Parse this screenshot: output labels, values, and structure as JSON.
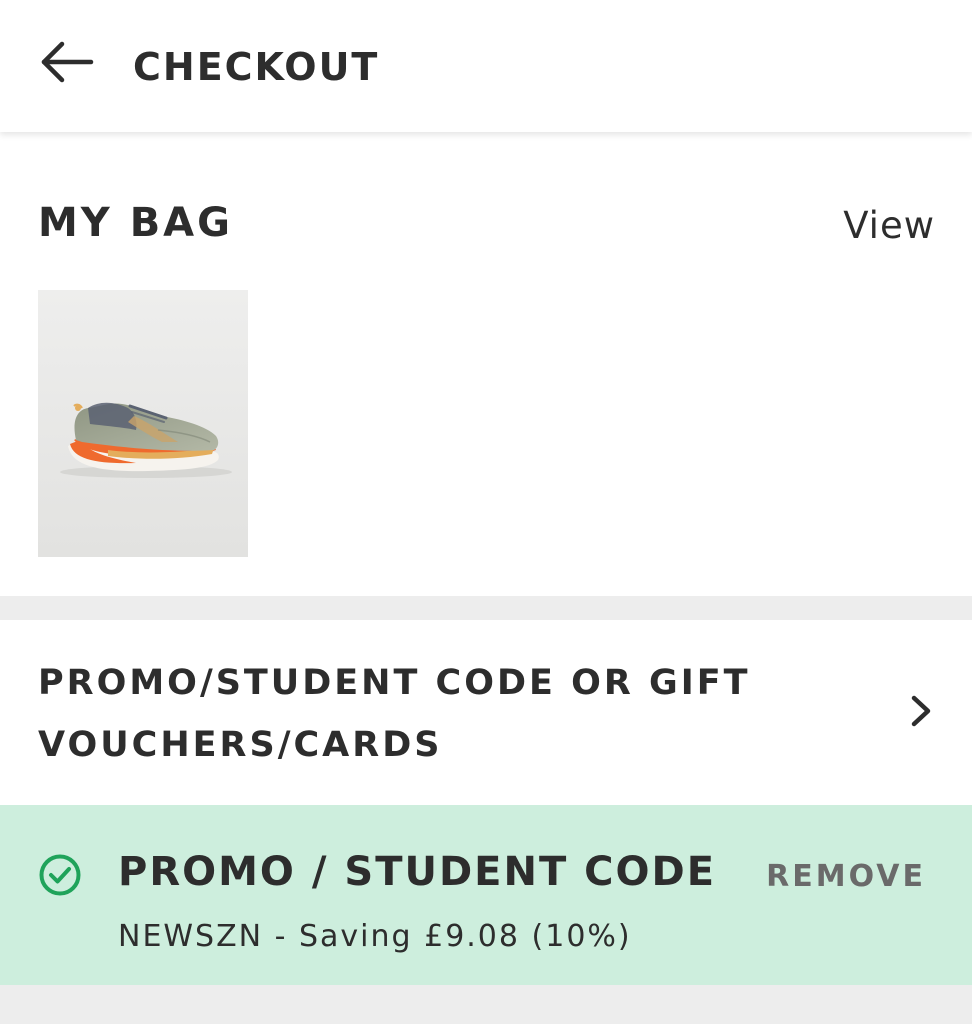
{
  "header": {
    "title": "CHECKOUT",
    "back_icon": "arrow-left-icon"
  },
  "bag": {
    "title": "MY BAG",
    "view_label": "View",
    "items": [
      {
        "image_desc": "sage green running shoe with orange sole",
        "colors": {
          "upper": "#9ea592",
          "midsole": "#ef6a2e",
          "accent": "#e4ad5c",
          "laces": "#5a6272"
        }
      }
    ]
  },
  "promo_entry": {
    "label": "PROMO/STUDENT CODE OR GIFT VOUCHERS/CARDS",
    "chevron_icon": "chevron-right-icon"
  },
  "applied_promo": {
    "status_icon": "check-circle-icon",
    "title": "PROMO / STUDENT CODE",
    "remove_label": "REMOVE",
    "detail": "NEWSZN - Saving £9.08 (10%)"
  },
  "colors": {
    "text": "#2d2d2d",
    "applied_bg": "#cdeedd",
    "success_green": "#1fa35a",
    "band_gray": "#ededed",
    "remove_gray": "#6a6a6a"
  }
}
